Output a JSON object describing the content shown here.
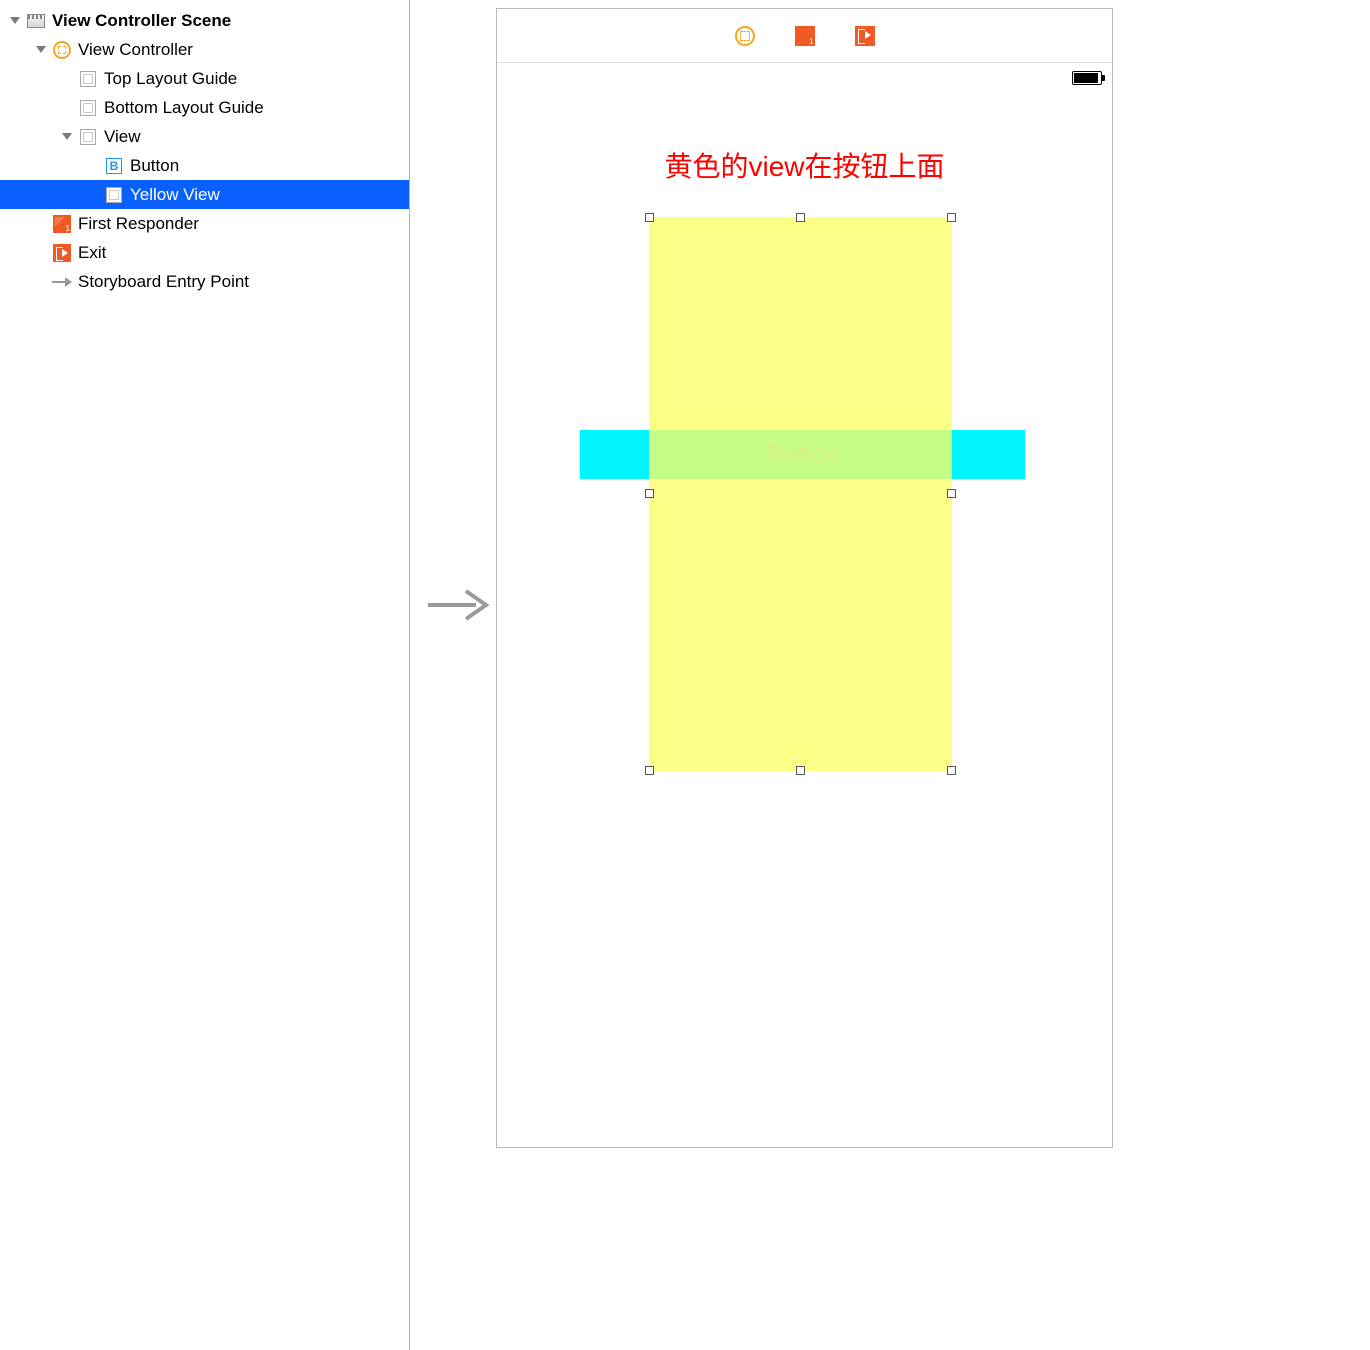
{
  "outline": {
    "scene": "View Controller Scene",
    "vc": "View Controller",
    "topGuide": "Top Layout Guide",
    "bottomGuide": "Bottom Layout Guide",
    "view": "View",
    "button": "Button",
    "yellowView": "Yellow View",
    "firstResponder": "First Responder",
    "exit": "Exit",
    "entryPoint": "Storyboard Entry Point"
  },
  "canvas": {
    "caption": "黄色的view在按钮上面",
    "buttonLabel": "Button"
  },
  "buttonIconGlyph": "B"
}
